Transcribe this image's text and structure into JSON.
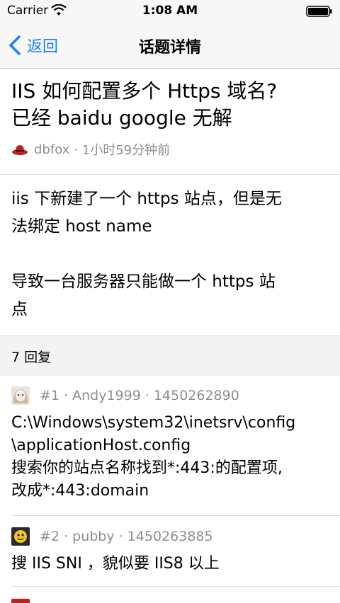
{
  "status_bar": {
    "carrier": "Carrier",
    "time": "1:08 AM"
  },
  "nav": {
    "back_label": "返回",
    "title": "话题详情"
  },
  "topic": {
    "title_line1": "IIS 如何配置多个 Https 域名?",
    "title_line2": "已经 baidu google 无解",
    "author": "dbfox",
    "time": "· 1小时59分钟前",
    "content": [
      "iis 下新建了一个 https 站点，但是无",
      "法绑定 host name",
      "导致一台服务器只能做一个 https 站",
      "点"
    ]
  },
  "replies_header": "7 回复",
  "replies": [
    {
      "meta": "#1 · Andy1999 · 1450262890",
      "lines": [
        "C:\\Windows\\system32\\inetsrv\\config",
        "\\applicationHost.config",
        "搜索你的站点名称找到*:443:的配置项,",
        "改成*:443:domain"
      ]
    },
    {
      "meta": "#2 · pubby · 1450263885",
      "lines": [
        "搜 IIS  SNI ，貌似要 IIS8 以上"
      ]
    }
  ],
  "colors": {
    "accent": "#1a7ef5",
    "meta": "#8e8e93"
  }
}
